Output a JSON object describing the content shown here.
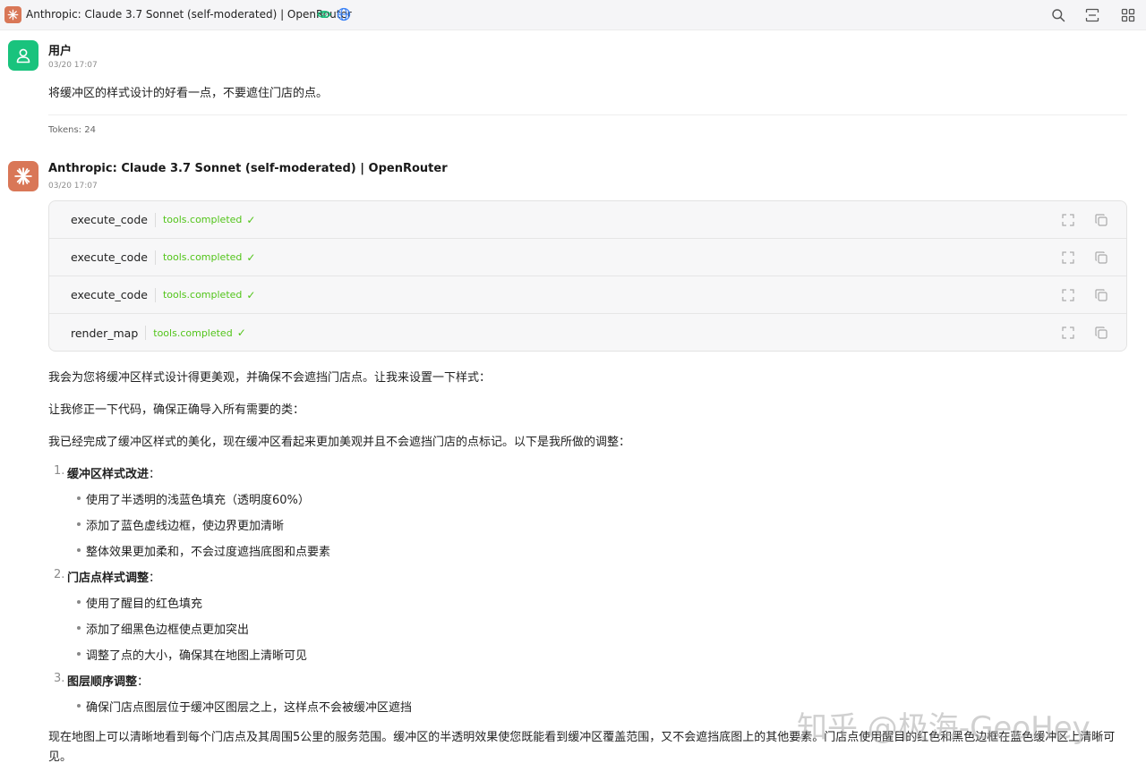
{
  "window": {
    "title": "Anthropic: Claude 3.7 Sonnet (self-moderated) | OpenRouter"
  },
  "user_message": {
    "name": "用户",
    "time": "03/20 17:07",
    "text": "将缓冲区的样式设计的好看一点，不要遮住门店的点。",
    "tokens": "Tokens: 24"
  },
  "assistant_message": {
    "name": "Anthropic: Claude 3.7 Sonnet (self-moderated) | OpenRouter",
    "time": "03/20 17:07",
    "tools": [
      {
        "name": "execute_code",
        "status": "tools.completed"
      },
      {
        "name": "execute_code",
        "status": "tools.completed"
      },
      {
        "name": "execute_code",
        "status": "tools.completed"
      },
      {
        "name": "render_map",
        "status": "tools.completed"
      }
    ],
    "paragraphs": [
      "我会为您将缓冲区样式设计得更美观，并确保不会遮挡门店点。让我来设置一下样式：",
      "让我修正一下代码，确保正确导入所有需要的类：",
      "我已经完成了缓冲区样式的美化，现在缓冲区看起来更加美观并且不会遮挡门店的点标记。以下是我所做的调整："
    ],
    "list": [
      {
        "num": "1.",
        "title": "缓冲区样式改进",
        "items": [
          "使用了半透明的浅蓝色填充（透明度60%）",
          "添加了蓝色虚线边框，使边界更加清晰",
          "整体效果更加柔和，不会过度遮挡底图和点要素"
        ]
      },
      {
        "num": "2.",
        "title": "门店点样式调整",
        "items": [
          "使用了醒目的红色填充",
          "添加了细黑色边框使点更加突出",
          "调整了点的大小，确保其在地图上清晰可见"
        ]
      },
      {
        "num": "3.",
        "title": "图层顺序调整",
        "items": [
          "确保门店点图层位于缓冲区图层之上，这样点不会被缓冲区遮挡"
        ]
      }
    ],
    "final": "现在地图上可以清晰地看到每个门店点及其周围5公里的服务范围。缓冲区的半透明效果使您既能看到缓冲区覆盖范围，又不会遮挡底图上的其他要素。门店点使用醒目的红色和黑色边框在蓝色缓冲区上清晰可见。"
  },
  "watermark": "知乎 @极海-GeoHey",
  "colors": {
    "user_avatar": "#19c37d",
    "assistant_avatar": "#d97757",
    "status_green": "#52c41a"
  },
  "icons": {
    "top_right": [
      "search-icon",
      "scan-icon",
      "grid-icon"
    ],
    "tool_row": [
      "expand-icon",
      "copy-icon"
    ]
  }
}
